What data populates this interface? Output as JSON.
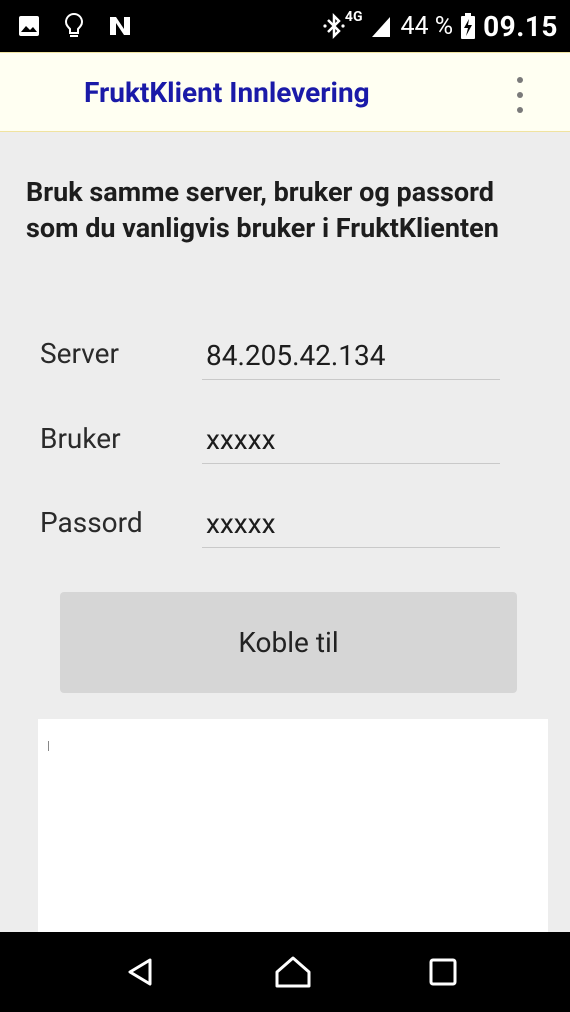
{
  "status_bar": {
    "icons_left": [
      "image-icon",
      "bulb-icon",
      "nfc-icon"
    ],
    "icons_right": [
      "bluetooth-icon",
      "signal-icon",
      "battery-charging-icon"
    ],
    "network": "4G",
    "battery": "44 %",
    "time": "09.15"
  },
  "app_bar": {
    "title": "FruktKlient Innlevering",
    "menu_icon": "more-vert-icon"
  },
  "colors": {
    "title": "#1a1aa8",
    "app_bar_bg": "#fffff2",
    "background": "#ededed",
    "button_bg": "#d6d6d6"
  },
  "main": {
    "instructions": "Bruk samme server, bruker og passord som du vanligvis bruker i FruktKlienten",
    "fields": {
      "server": {
        "label": "Server",
        "value": "84.205.42.134"
      },
      "user": {
        "label": "Bruker",
        "value": "xxxxx"
      },
      "password": {
        "label": "Passord",
        "value": "xxxxx"
      }
    },
    "connect_label": "Koble til"
  },
  "nav_bar": {
    "icons": [
      "back-icon",
      "home-icon",
      "recents-icon"
    ]
  }
}
